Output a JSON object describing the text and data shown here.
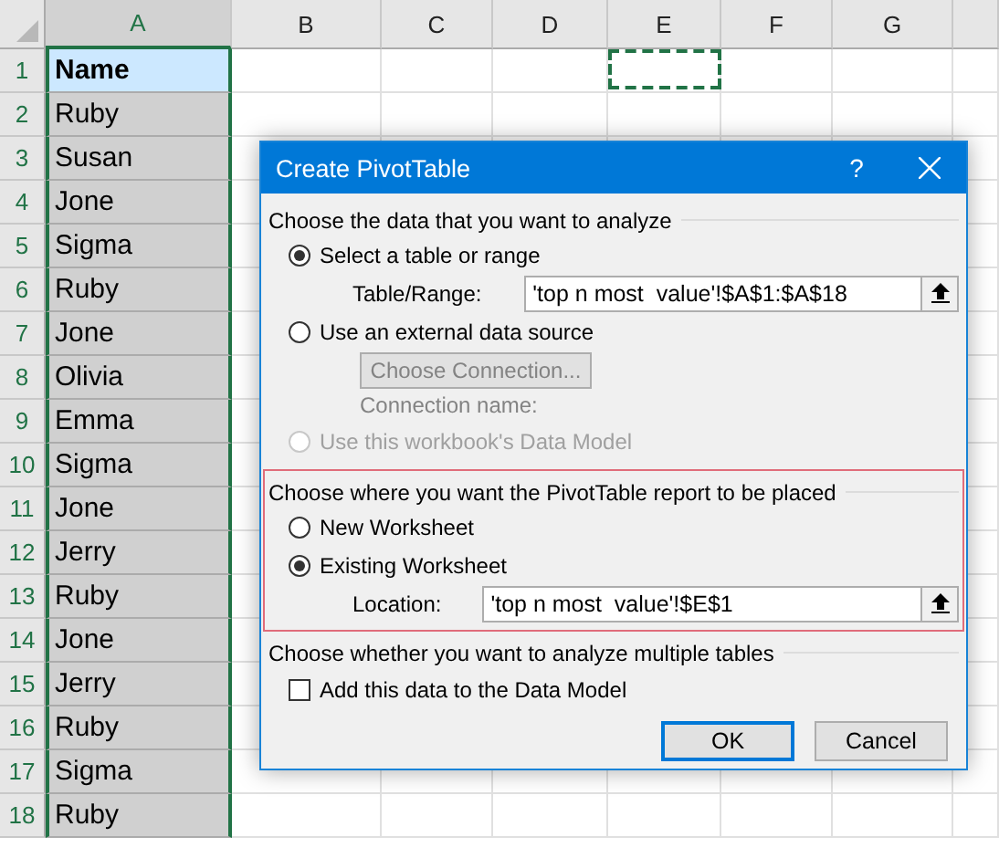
{
  "sheet": {
    "columns": [
      {
        "label": "A",
        "selected": true,
        "marquee": false
      },
      {
        "label": "B",
        "selected": false,
        "marquee": false
      },
      {
        "label": "C",
        "selected": false,
        "marquee": false
      },
      {
        "label": "D",
        "selected": false,
        "marquee": false
      },
      {
        "label": "E",
        "selected": false,
        "marquee": true
      },
      {
        "label": "F",
        "selected": false,
        "marquee": false
      },
      {
        "label": "G",
        "selected": false,
        "marquee": false
      }
    ],
    "rows": [
      {
        "number": "1",
        "value": "Name",
        "kind": "header",
        "active": true
      },
      {
        "number": "2",
        "value": "Ruby",
        "kind": "data",
        "active": false
      },
      {
        "number": "3",
        "value": "Susan",
        "kind": "data",
        "active": false
      },
      {
        "number": "4",
        "value": "Jone",
        "kind": "data",
        "active": false
      },
      {
        "number": "5",
        "value": "Sigma",
        "kind": "data",
        "active": false
      },
      {
        "number": "6",
        "value": "Ruby",
        "kind": "data",
        "active": false
      },
      {
        "number": "7",
        "value": "Jone",
        "kind": "data",
        "active": false
      },
      {
        "number": "8",
        "value": "Olivia",
        "kind": "data",
        "active": false
      },
      {
        "number": "9",
        "value": "Emma",
        "kind": "data",
        "active": false
      },
      {
        "number": "10",
        "value": "Sigma",
        "kind": "data",
        "active": false
      },
      {
        "number": "11",
        "value": "Jone",
        "kind": "data",
        "active": false
      },
      {
        "number": "12",
        "value": "Jerry",
        "kind": "data",
        "active": false
      },
      {
        "number": "13",
        "value": "Ruby",
        "kind": "data",
        "active": false
      },
      {
        "number": "14",
        "value": "Jone",
        "kind": "data",
        "active": false
      },
      {
        "number": "15",
        "value": "Jerry",
        "kind": "data",
        "active": false
      },
      {
        "number": "16",
        "value": "Ruby",
        "kind": "data",
        "active": false
      },
      {
        "number": "17",
        "value": "Sigma",
        "kind": "data",
        "active": false
      },
      {
        "number": "18",
        "value": "Ruby",
        "kind": "data",
        "active": false
      }
    ]
  },
  "dialog": {
    "title": "Create PivotTable",
    "help": "?",
    "data_source": {
      "heading": "Choose the data that you want to analyze",
      "options": [
        {
          "label": "Select a table or range",
          "selected": true,
          "disabled": false
        },
        {
          "label": "Use an external data source",
          "selected": false,
          "disabled": false
        },
        {
          "label": "Use this workbook's Data Model",
          "selected": false,
          "disabled": true
        }
      ],
      "range_label": "Table/Range:",
      "range_value": "'top n most  value'!$A$1:$A$18",
      "connection_button": "Choose Connection...",
      "connection_label": "Connection name:"
    },
    "placement": {
      "heading": "Choose where you want the PivotTable report to be placed",
      "highlighted": true,
      "options": [
        {
          "label": "New Worksheet",
          "selected": false,
          "disabled": false
        },
        {
          "label": "Existing Worksheet",
          "selected": true,
          "disabled": false
        }
      ],
      "location_label": "Location:",
      "location_value": "'top n most  value'!$E$1"
    },
    "multiple_tables": {
      "heading": "Choose whether you want to analyze multiple tables",
      "checkbox": {
        "label": "Add this data to the Data Model",
        "checked": false
      }
    },
    "buttons": [
      {
        "label": "OK",
        "default": true
      },
      {
        "label": "Cancel",
        "default": false
      }
    ]
  }
}
